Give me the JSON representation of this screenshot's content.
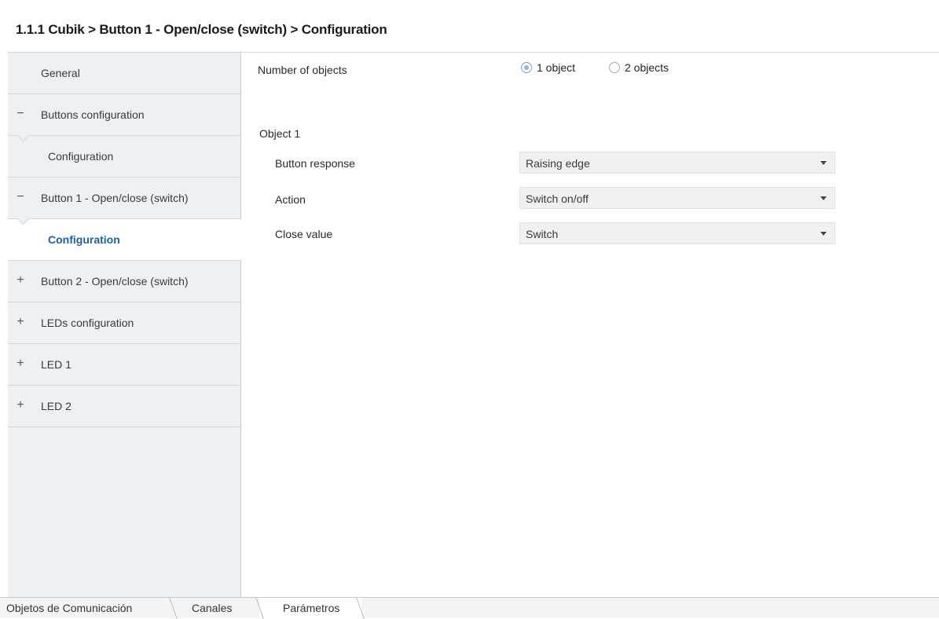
{
  "window": {
    "title": "1.1.1 Cubik > Button 1 - Open/close (switch) > Configuration"
  },
  "sidebar": {
    "items": [
      {
        "label": "General",
        "sign": ""
      },
      {
        "label": "Buttons configuration",
        "sign": "−"
      },
      {
        "label": "Configuration",
        "sign": ""
      },
      {
        "label": "Button 1 - Open/close (switch)",
        "sign": "−"
      },
      {
        "label": "Configuration",
        "sign": ""
      },
      {
        "label": "Button 2 - Open/close (switch)",
        "sign": "+"
      },
      {
        "label": "LEDs configuration",
        "sign": "+"
      },
      {
        "label": "LED 1",
        "sign": "+"
      },
      {
        "label": "LED 2",
        "sign": "+"
      }
    ]
  },
  "main": {
    "number_of_objects": {
      "label": "Number of objects",
      "options": [
        "1 object",
        "2 objects"
      ],
      "selected": "1 object"
    },
    "section_title": "Object 1",
    "fields": [
      {
        "label": "Button response",
        "value": "Raising edge"
      },
      {
        "label": "Action",
        "value": "Switch on/off"
      },
      {
        "label": "Close value",
        "value": "Switch"
      }
    ]
  },
  "tabs": [
    {
      "label": "Objetos de Comunicación"
    },
    {
      "label": "Canales"
    },
    {
      "label": "Parámetros"
    }
  ],
  "colors": {
    "active_nav_text": "#1f5f9e",
    "sidebar_bg": "#eef1f4",
    "radio_selected": "#8fb5e0"
  }
}
